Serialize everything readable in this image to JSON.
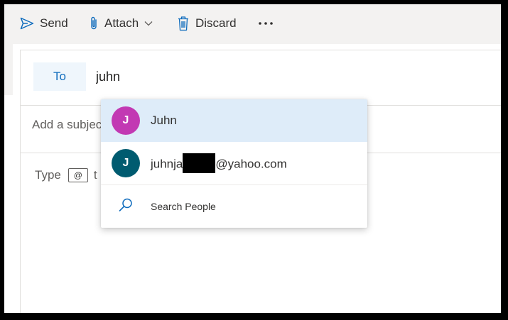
{
  "toolbar": {
    "send_label": "Send",
    "attach_label": "Attach",
    "discard_label": "Discard",
    "more_label": "···"
  },
  "recipients": {
    "to_label": "To",
    "to_value": "juhn"
  },
  "subject": {
    "placeholder": "Add a subject"
  },
  "body": {
    "hint_prefix": "Type",
    "mention_symbol": "@",
    "hint_rest": "t"
  },
  "suggestions": [
    {
      "initial": "J",
      "name": "Juhn",
      "avatar_color": "#c239b3",
      "selected": true
    },
    {
      "initial": "J",
      "email_prefix": "juhnja",
      "email_suffix": "@yahoo.com",
      "avatar_color": "#005b70",
      "redacted": true
    }
  ],
  "search_people": {
    "label": "Search People",
    "icon": "search-icon"
  },
  "colors": {
    "accent": "#0f6cbd",
    "toolbar_bg": "#f3f2f1",
    "selected_bg": "#deecf9"
  }
}
